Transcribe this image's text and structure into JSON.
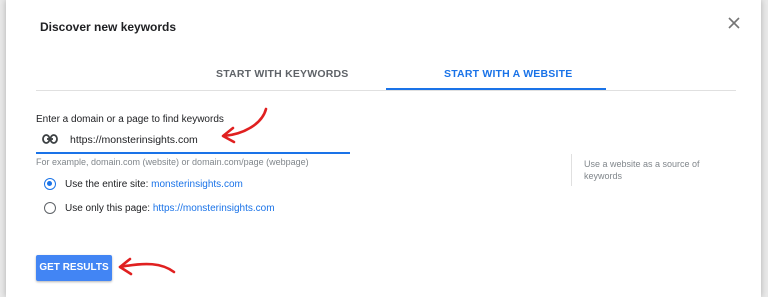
{
  "dialog": {
    "title": "Discover new keywords",
    "close_icon": "close-icon"
  },
  "tabs": [
    {
      "label": "START WITH KEYWORDS",
      "active": false
    },
    {
      "label": "START WITH A WEBSITE",
      "active": true
    }
  ],
  "website_form": {
    "field_label": "Enter a domain or a page to find keywords",
    "url_value": "https://monsterinsights.com",
    "input_icon": "link-icon",
    "helper_text": "For example, domain.com (website) or domain.com/page (webpage)",
    "side_help": "Use a website as a source of keywords",
    "options": [
      {
        "prefix": "Use the entire site:",
        "link": "monsterinsights.com",
        "selected": true
      },
      {
        "prefix": "Use only this page:",
        "link": "https://monsterinsights.com",
        "selected": false
      }
    ]
  },
  "actions": {
    "get_results_label": "GET RESULTS"
  },
  "annotations": {
    "color": "#e02020"
  },
  "colors": {
    "accent": "#1a73e8",
    "button": "#4285f4"
  }
}
